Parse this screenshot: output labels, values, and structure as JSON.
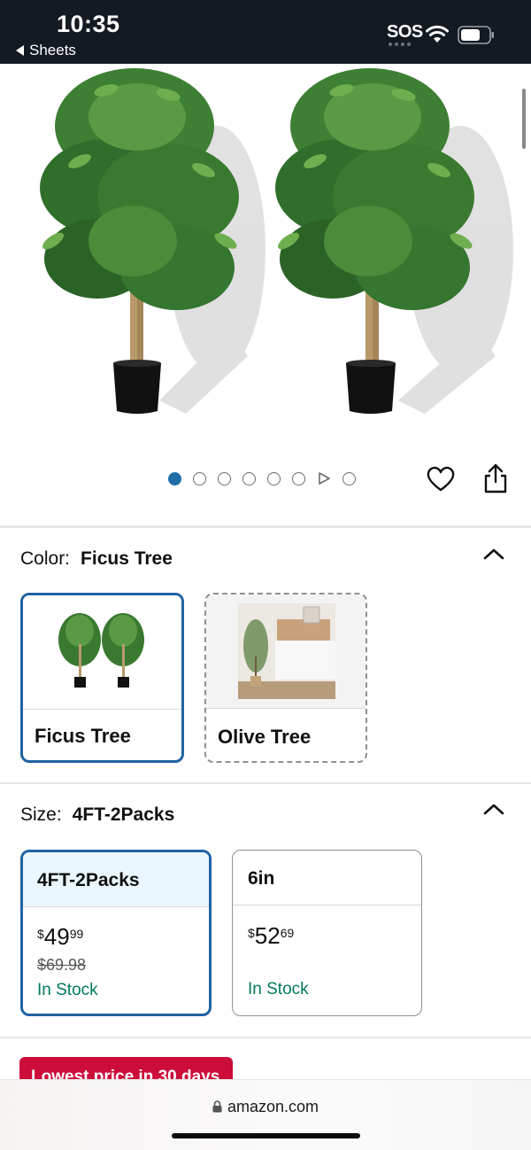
{
  "status_bar": {
    "time": "10:35",
    "back_app": "Sheets",
    "sos": "SOS",
    "icons": [
      "wifi-icon",
      "battery-icon"
    ]
  },
  "product_image": {
    "alt": "two potted ficus trees",
    "carousel": {
      "total_dots": 8,
      "active_index": 0,
      "video_index": 6
    },
    "actions": [
      "heart-icon",
      "share-icon"
    ]
  },
  "color": {
    "label": "Color:",
    "selected": "Ficus Tree",
    "options": [
      {
        "label": "Ficus Tree",
        "selected": true
      },
      {
        "label": "Olive Tree",
        "selected": false
      }
    ]
  },
  "size": {
    "label": "Size:",
    "selected": "4FT-2Packs",
    "options": [
      {
        "label": "4FT-2Packs",
        "price_symbol": "$",
        "price_whole": "49",
        "price_fraction": "99",
        "list_price": "$69.98",
        "availability": "In Stock",
        "selected": true
      },
      {
        "label": "6in",
        "price_symbol": "$",
        "price_whole": "52",
        "price_fraction": "69",
        "list_price": "",
        "availability": "In Stock",
        "selected": false
      }
    ]
  },
  "deal_badge": "Lowest price in 30 days",
  "browser": {
    "url": "amazon.com"
  },
  "colors": {
    "status_bg": "#131a22",
    "selected_border": "#2162a1",
    "in_stock": "#007a5f",
    "deal_badge": "#cc0c39",
    "active_dot": "#1f6ea8"
  }
}
